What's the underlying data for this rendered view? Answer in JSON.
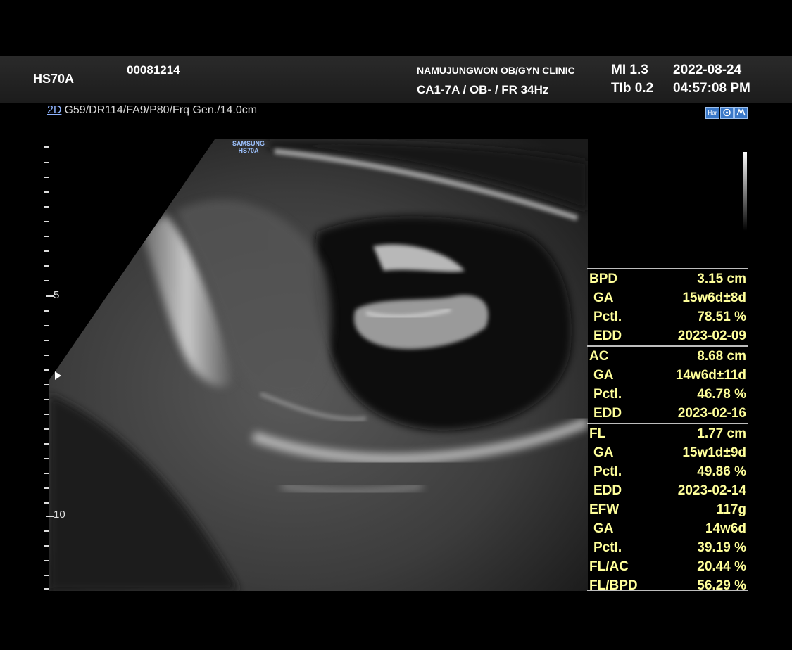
{
  "header": {
    "model": "HS70A",
    "patient_id": "00081214",
    "clinic": "NAMUJUNGWON OB/GYN CLINIC",
    "probe_preset": "CA1-7A / OB- / FR 34Hz",
    "mi": "MI  1.3",
    "tib": "TIb 0.2",
    "date": "2022-08-24",
    "time": "04:57:08 PM"
  },
  "image_params": {
    "mode": "2D",
    "settings": "G59/DR114/FA9/P80/Frq Gen./14.0cm"
  },
  "mode_icons": [
    "Har",
    "icon-b",
    "icon-m"
  ],
  "brand": {
    "line1": "SAMSUNG",
    "line2": "HS70A"
  },
  "depth_scale": {
    "label_5": "5",
    "label_10": "10"
  },
  "measurements": [
    {
      "label": "BPD",
      "value": "3.15 cm",
      "sub": false,
      "sep": true
    },
    {
      "label": "GA",
      "value": "15w6d±8d",
      "sub": true,
      "sep": false
    },
    {
      "label": "Pctl.",
      "value": "78.51 %",
      "sub": true,
      "sep": false
    },
    {
      "label": "EDD",
      "value": "2023-02-09",
      "sub": true,
      "sep": false
    },
    {
      "label": "AC",
      "value": "8.68 cm",
      "sub": false,
      "sep": true
    },
    {
      "label": "GA",
      "value": "14w6d±11d",
      "sub": true,
      "sep": false
    },
    {
      "label": "Pctl.",
      "value": "46.78 %",
      "sub": true,
      "sep": false
    },
    {
      "label": "EDD",
      "value": "2023-02-16",
      "sub": true,
      "sep": false
    },
    {
      "label": "FL",
      "value": "1.77 cm",
      "sub": false,
      "sep": true
    },
    {
      "label": "GA",
      "value": "15w1d±9d",
      "sub": true,
      "sep": false
    },
    {
      "label": "Pctl.",
      "value": "49.86 %",
      "sub": true,
      "sep": false
    },
    {
      "label": "EDD",
      "value": "2023-02-14",
      "sub": true,
      "sep": false
    },
    {
      "label": "EFW",
      "value": "117g",
      "sub": false,
      "sep": false
    },
    {
      "label": "GA",
      "value": "14w6d",
      "sub": true,
      "sep": false
    },
    {
      "label": "Pctl.",
      "value": "39.19 %",
      "sub": true,
      "sep": false
    },
    {
      "label": "FL/AC",
      "value": "20.44 %",
      "sub": false,
      "sep": false
    },
    {
      "label": "FL/BPD",
      "value": "56.29 %",
      "sub": false,
      "sep": false
    }
  ],
  "colors": {
    "measurement_text": "#ffff9a",
    "header_bg": "#222222",
    "mode_accent": "#3a78c8"
  }
}
